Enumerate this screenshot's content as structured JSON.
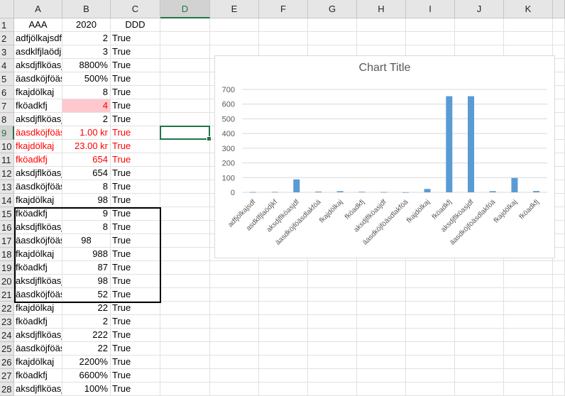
{
  "columns": [
    "A",
    "B",
    "C",
    "D",
    "E",
    "F",
    "G",
    "H",
    "I",
    "J",
    "K"
  ],
  "selected_column": "D",
  "selected_row": 9,
  "header_row": {
    "a": "AAA",
    "b": "2020",
    "c": "DDD"
  },
  "rows": [
    {
      "num": "2",
      "a": "adfjölkajsdf",
      "b": "2",
      "c": "True"
    },
    {
      "num": "3",
      "a": "asdklfjlaödjkf",
      "b": "3",
      "c": "True"
    },
    {
      "num": "4",
      "a": "aksdjflköasjdf",
      "b": "8800%",
      "c": "True"
    },
    {
      "num": "5",
      "a": "äasdköjföäsdlakföä",
      "b": "500%",
      "c": "True"
    },
    {
      "num": "6",
      "a": "fkajdölkaj",
      "b": "8",
      "c": "True"
    },
    {
      "num": "7",
      "a": "fköadkfj",
      "b": "4",
      "c": "True",
      "b_fill": "pink",
      "b_red": true
    },
    {
      "num": "8",
      "a": "aksdjflköasjdf",
      "b": "2",
      "c": "True"
    },
    {
      "num": "9",
      "a": "äasdköjföäsdlakföä",
      "b": "1.00 kr",
      "c": "True",
      "red": true
    },
    {
      "num": "10",
      "a": "fkajdölkaj",
      "b": "23.00 kr",
      "c": "True",
      "red": true
    },
    {
      "num": "11",
      "a": "fköadkfj",
      "b": "654",
      "c": "True",
      "red": true
    },
    {
      "num": "12",
      "a": "aksdjflköasjdf",
      "b": "654",
      "c": "True"
    },
    {
      "num": "13",
      "a": "äasdköjföäsdlakföä",
      "b": "8",
      "c": "True"
    },
    {
      "num": "14",
      "a": "fkajdölkaj",
      "b": "98",
      "c": "True"
    },
    {
      "num": "15",
      "a": "fköadkfj",
      "b": "9",
      "c": "True"
    },
    {
      "num": "16",
      "a": "aksdjflköasjdf",
      "b": "8",
      "c": "True"
    },
    {
      "num": "17",
      "a": "äasdköjföäsdlakföä",
      "b": "98",
      "c": "True",
      "b_align": "center"
    },
    {
      "num": "18",
      "a": "fkajdölkaj",
      "b": "988",
      "c": "True"
    },
    {
      "num": "19",
      "a": "fköadkfj",
      "b": "87",
      "c": "True"
    },
    {
      "num": "20",
      "a": "aksdjflköasjdf",
      "b": "98",
      "c": "True"
    },
    {
      "num": "21",
      "a": "äasdköjföäsdlakföä",
      "b": "52",
      "c": "True"
    },
    {
      "num": "22",
      "a": "fkajdölkaj",
      "b": "22",
      "c": "True"
    },
    {
      "num": "23",
      "a": "fköadkfj",
      "b": "2",
      "c": "True"
    },
    {
      "num": "24",
      "a": "aksdjflköasjdf",
      "b": "222",
      "c": "True"
    },
    {
      "num": "25",
      "a": "äasdköjföäsdlakföä",
      "b": "22",
      "c": "True"
    },
    {
      "num": "26",
      "a": "fkajdölkaj",
      "b": "2200%",
      "c": "True"
    },
    {
      "num": "27",
      "a": "fköadkfj",
      "b": "6600%",
      "c": "True"
    },
    {
      "num": "28",
      "a": "aksdjflköasjdf",
      "b": "100%",
      "c": "True"
    }
  ],
  "colors": {
    "accent": "#217346",
    "bar": "#5b9bd5",
    "red": "#ff0000",
    "pink": "#ffc7ce",
    "gridline": "#d9d9d9"
  },
  "chart_data": {
    "type": "bar",
    "title": "Chart Title",
    "categories": [
      "adfjölkajsdf",
      "asdklfjlaödjkf",
      "aksdjflköasjdf",
      "äasdköjföäsdlakföä",
      "fkajdölkaj",
      "fköadkfj",
      "aksdjflköasjdf",
      "äasdköjföäsdlakföä",
      "fkajdölkaj",
      "fköadkfj",
      "aksdjflköasjdf",
      "äasdköjföäsdlakföä",
      "fkajdölkaj",
      "fköadkfj"
    ],
    "values": [
      2,
      3,
      88,
      5,
      8,
      4,
      2,
      1,
      23,
      654,
      654,
      8,
      98,
      9
    ],
    "yticks": [
      "0",
      "100",
      "200",
      "300",
      "400",
      "500",
      "600",
      "700"
    ],
    "ylim": [
      0,
      700
    ],
    "grid": true,
    "legend": "none"
  }
}
